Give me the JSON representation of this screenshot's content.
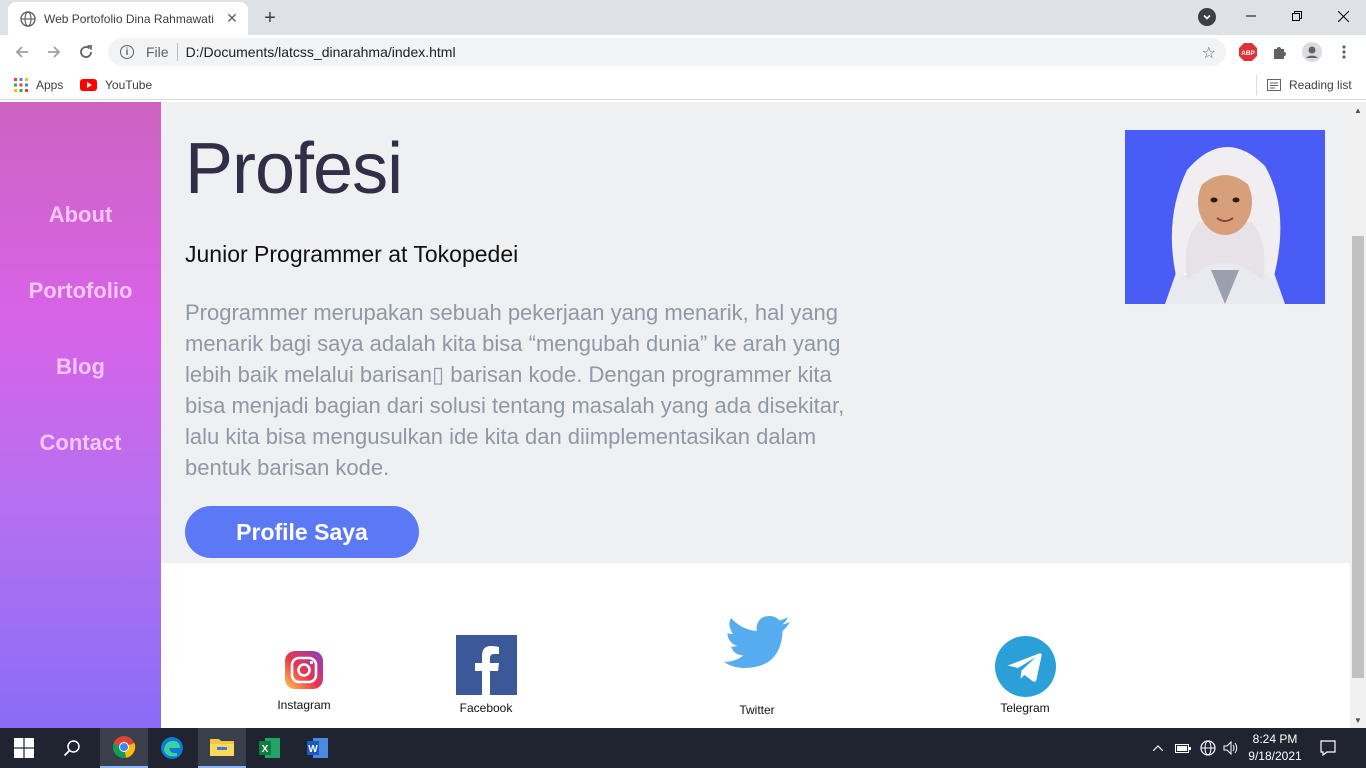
{
  "browser": {
    "tab_title": "Web Portofolio Dina Rahmawati",
    "address_protocol": "File",
    "address_url": "D:/Documents/latcss_dinarahma/index.html",
    "bookmarks": [
      {
        "label": "Apps"
      },
      {
        "label": "YouTube"
      }
    ],
    "reading_list": "Reading list"
  },
  "sidebar": {
    "items": [
      {
        "label": "About"
      },
      {
        "label": "Portofolio"
      },
      {
        "label": "Blog"
      },
      {
        "label": "Contact"
      }
    ]
  },
  "hero": {
    "title": "Profesi",
    "subtitle": "Junior Programmer at Tokopedei",
    "description": "Programmer merupakan sebuah pekerjaan yang menarik, hal yang menarik bagi saya adalah kita bisa “mengubah dunia” ke arah yang lebih baik melalui barisan▯ barisan kode. Dengan programmer kita bisa menjadi bagian dari solusi tentang masalah yang ada disekitar, lalu kita bisa mengusulkan ide kita dan diimplementasikan dalam bentuk barisan kode.",
    "button_label": "Profile Saya"
  },
  "social": {
    "items": [
      {
        "label": "Instagram",
        "icon": "instagram-icon"
      },
      {
        "label": "Facebook",
        "icon": "facebook-icon"
      },
      {
        "label": "Twitter",
        "icon": "twitter-icon"
      },
      {
        "label": "Telegram",
        "icon": "telegram-icon"
      }
    ]
  },
  "taskbar": {
    "clock_time": "8:24 PM",
    "clock_date": "9/18/2021"
  },
  "colors": {
    "accent_button": "#5c79f5",
    "sidebar_top": "#cd63c1",
    "sidebar_bottom": "#8a6cf6",
    "hero_bg": "#eff0f2"
  }
}
